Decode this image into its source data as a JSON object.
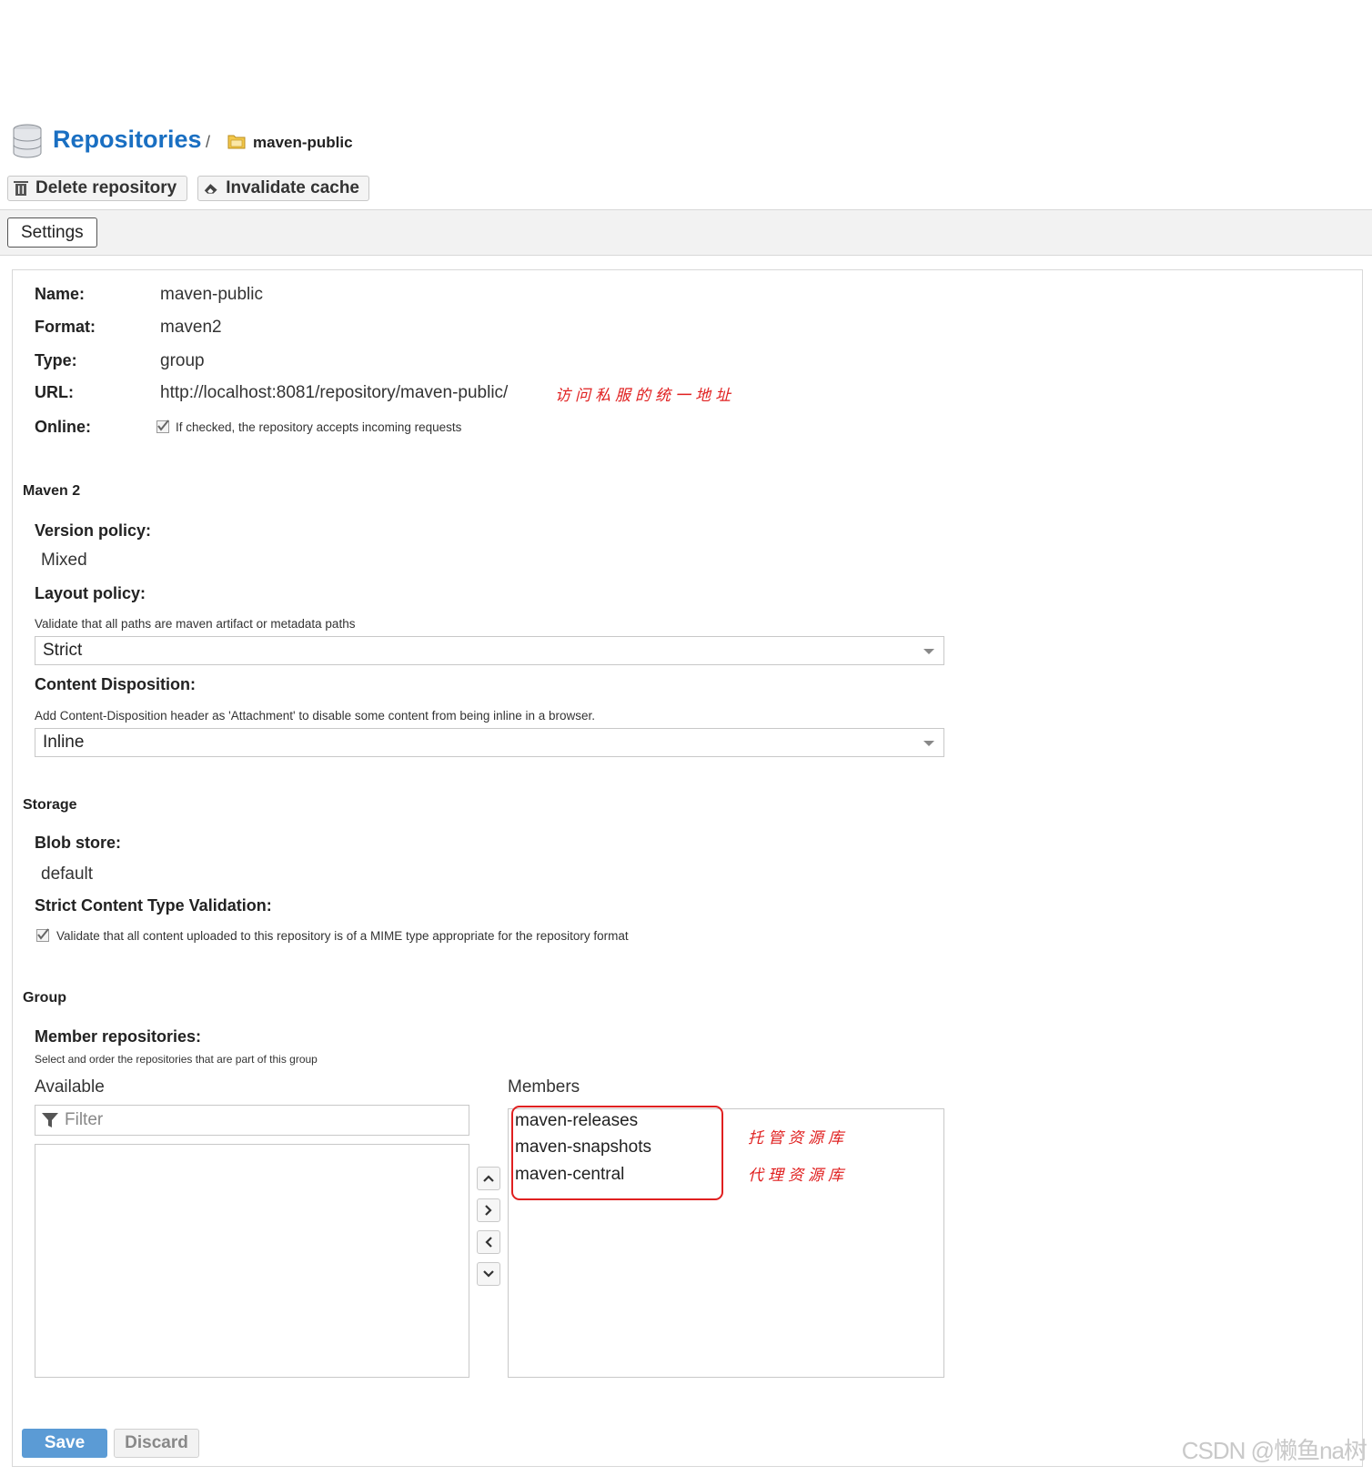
{
  "breadcrumb": {
    "title": "Repositories",
    "separator": "/",
    "repo": "maven-public"
  },
  "toolbar": {
    "delete_label": "Delete repository",
    "invalidate_label": "Invalidate cache"
  },
  "tabs": {
    "settings": "Settings"
  },
  "info": {
    "name_label": "Name:",
    "name_value": "maven-public",
    "format_label": "Format:",
    "format_value": "maven2",
    "type_label": "Type:",
    "type_value": "group",
    "url_label": "URL:",
    "url_value": "http://localhost:8081/repository/maven-public/",
    "url_annotation": "访问私服的统一地址",
    "online_label": "Online:",
    "online_text": "If checked, the repository accepts incoming requests",
    "online_checked": true
  },
  "maven2": {
    "section": "Maven 2",
    "version_policy_label": "Version policy:",
    "version_policy_value": "Mixed",
    "layout_policy_label": "Layout policy:",
    "layout_policy_help": "Validate that all paths are maven artifact or metadata paths",
    "layout_policy_value": "Strict",
    "content_disposition_label": "Content Disposition:",
    "content_disposition_help": "Add Content-Disposition header as 'Attachment' to disable some content from being inline in a browser.",
    "content_disposition_value": "Inline"
  },
  "storage": {
    "section": "Storage",
    "blob_store_label": "Blob store:",
    "blob_store_value": "default",
    "strict_label": "Strict Content Type Validation:",
    "strict_text": "Validate that all content uploaded to this repository is of a MIME type appropriate for the repository format",
    "strict_checked": true
  },
  "group": {
    "section": "Group",
    "member_label": "Member repositories:",
    "member_help": "Select and order the repositories that are part of this group",
    "available_label": "Available",
    "filter_placeholder": "Filter",
    "members_label": "Members",
    "members": [
      "maven-releases",
      "maven-snapshots",
      "maven-central"
    ],
    "annotation_hosted": "托管资源库",
    "annotation_proxy": "代理资源库"
  },
  "footer": {
    "save_label": "Save",
    "discard_label": "Discard",
    "watermark": "CSDN @懒鱼na树"
  },
  "colors": {
    "accent": "#1a6fc2",
    "save": "#5b9bd5",
    "annotation": "#e02020"
  }
}
